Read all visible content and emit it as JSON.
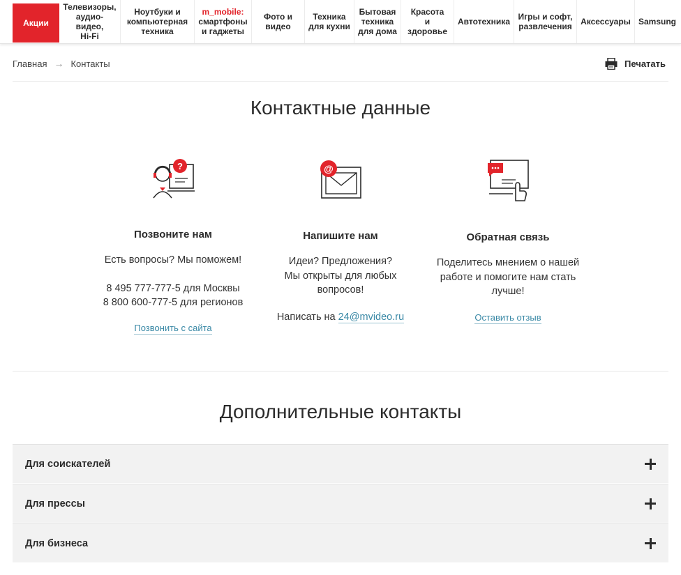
{
  "nav": {
    "items": [
      {
        "label": "Акции"
      },
      {
        "label": "Телевизоры,\nаудио-видео,\nHi-Fi"
      },
      {
        "label": "Ноутбуки и\nкомпьютерная\nтехника"
      },
      {
        "label_red": "m_mobile:",
        "label": "смартфоны\nи гаджеты"
      },
      {
        "label": "Фото и\nвидео"
      },
      {
        "label": "Техника\nдля кухни"
      },
      {
        "label": "Бытовая\nтехника\nдля дома"
      },
      {
        "label": "Красота\nи здоровье"
      },
      {
        "label": "Автотехника"
      },
      {
        "label": "Игры и софт,\nразвлечения"
      },
      {
        "label": "Аксессуары"
      },
      {
        "label": "Samsung"
      }
    ]
  },
  "breadcrumb": {
    "home": "Главная",
    "current": "Контакты"
  },
  "print_label": "Печатать",
  "contacts": {
    "title": "Контактные данные",
    "call": {
      "heading": "Позвоните нам",
      "line1": "Есть вопросы? Мы поможем!",
      "line2": "8 495 777-777-5 для Москвы",
      "line3": "8 800 600-777-5 для регионов",
      "link": "Позвонить с сайта"
    },
    "write": {
      "heading": "Напишите нам",
      "line1": "Идеи? Предложения?",
      "line2": "Мы открыты для любых",
      "line3": "вопросов!",
      "email_prefix": "Написать на",
      "email": "24@mvideo.ru"
    },
    "feedback": {
      "heading": "Обратная связь",
      "line1": "Поделитесь мнением о нашей",
      "line2": "работе и помогите нам стать",
      "line3": "лучше!",
      "link": "Оставить отзыв"
    }
  },
  "additional": {
    "title": "Дополнительные контакты",
    "items": [
      {
        "label": "Для соискателей"
      },
      {
        "label": "Для прессы"
      },
      {
        "label": "Для бизнеса"
      }
    ]
  },
  "colors": {
    "brand": "#e2242b",
    "link": "#3a89a6"
  }
}
